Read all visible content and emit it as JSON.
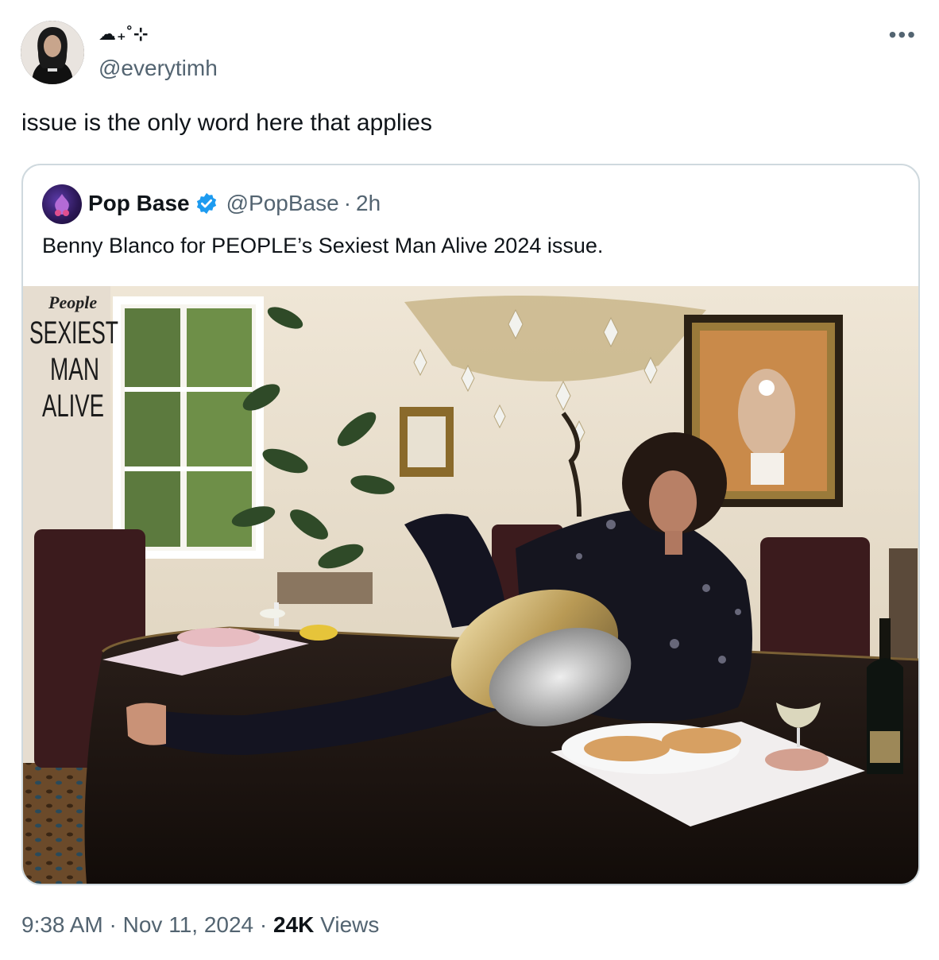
{
  "author": {
    "display_name": "☁︎₊˚⊹",
    "handle": "@everytimh",
    "avatar_icon": "profile-avatar"
  },
  "more_icon": "more-horizontal-icon",
  "tweet_text": "issue is the only word here that applies",
  "quoted": {
    "name": "Pop Base",
    "verified": true,
    "verified_color": "#1d9bf0",
    "handle": "@PopBase",
    "separator": "·",
    "time": "2h",
    "text": "Benny Blanco for PEOPLE’s Sexiest Man Alive 2024 issue.",
    "media": {
      "magazine_logo": "People",
      "cover_line_1": "SEXIEST",
      "cover_line_2": "MAN",
      "cover_line_3": "ALIVE"
    }
  },
  "footer": {
    "time": "9:38 AM",
    "sep1": "·",
    "date": "Nov 11, 2024",
    "sep2": "·",
    "views_count": "24K",
    "views_label": "Views"
  }
}
